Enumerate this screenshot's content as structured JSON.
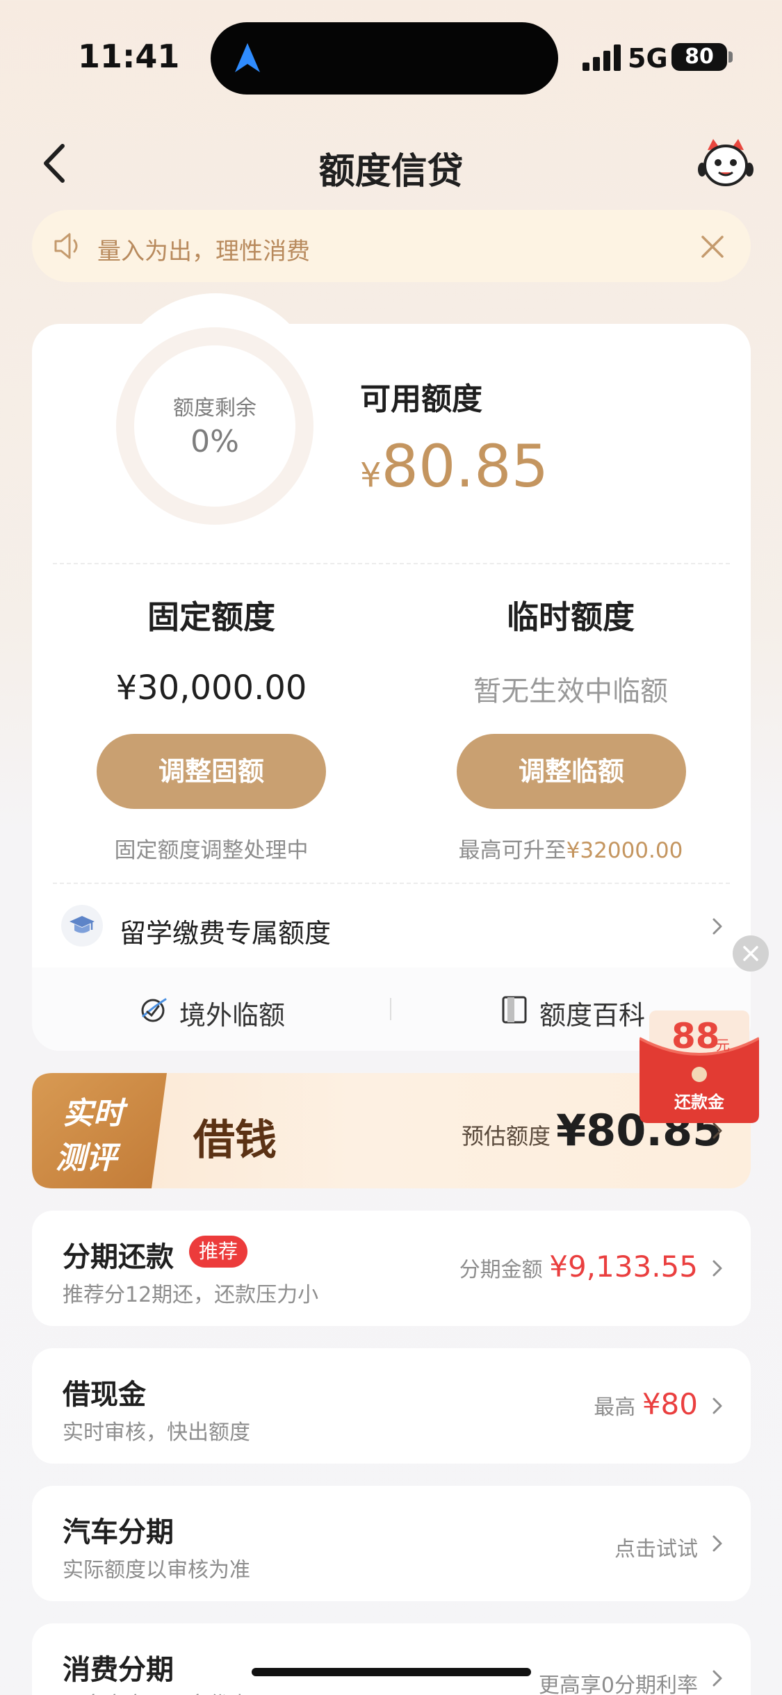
{
  "status_bar": {
    "time": "11:41",
    "network": "5G",
    "battery": "80"
  },
  "header": {
    "title": "额度信贷"
  },
  "notice": {
    "text": "量入为出，理性消费"
  },
  "quota": {
    "ring_label": "额度剩余",
    "ring_value": "0%",
    "ring_fraction": 0,
    "available_label": "可用额度",
    "available_currency": "¥",
    "available_amount": "80.85"
  },
  "fixed": {
    "title": "固定额度",
    "amount": "¥30,000.00",
    "button": "调整固额",
    "note": "固定额度调整处理中"
  },
  "temporary": {
    "title": "临时额度",
    "note": "暂无生效中临额",
    "button": "调整临额",
    "max_prefix": "最高可升至",
    "max_amount": "¥32000.00"
  },
  "study_abroad": {
    "label": "留学缴费专属额度"
  },
  "sub_links": {
    "overseas": "境外临额",
    "encyclopedia": "额度百科"
  },
  "loan_banner": {
    "tag_line1": "实时",
    "tag_line2": "测评",
    "title": "借钱",
    "estimate_label": "预估额度",
    "estimate_value": "¥80.85"
  },
  "red_packet": {
    "amount": "88",
    "unit": "元",
    "label": "还款金"
  },
  "list": [
    {
      "title": "分期还款",
      "badge": "推荐",
      "subtitle": "推荐分12期还，还款压力小",
      "right_label": "分期金额",
      "right_value": "¥9,133.55"
    },
    {
      "title": "借现金",
      "subtitle": "实时审核，快出额度",
      "right_label": "最高",
      "right_value": "¥80"
    },
    {
      "title": "汽车分期",
      "subtitle": "实际额度以审核为准",
      "right_label": "点击试试",
      "right_value": ""
    },
    {
      "title": "消费分期",
      "subtitle": "更多商户，更多优惠",
      "right_label": "更高享0分期利率",
      "right_value": ""
    }
  ],
  "colors": {
    "accent_gold": "#c9a071",
    "amount_gold": "#c4955f",
    "red": "#ea3f3f",
    "loan_brown": "#5b3214"
  }
}
